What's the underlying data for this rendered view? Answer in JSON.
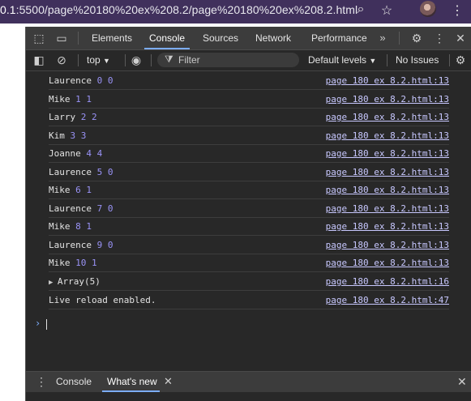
{
  "browser": {
    "url_bold": "0.1",
    "url_rest": ":5500/page%20180%20ex%208.2/page%20180%20ex%208.2.html"
  },
  "devtools": {
    "tabs": [
      "Elements",
      "Console",
      "Sources",
      "Network",
      "Performance"
    ],
    "active_tab": "Console",
    "toolbar": {
      "context": "top",
      "filter_placeholder": "Filter",
      "levels": "Default levels",
      "issues": "No Issues"
    },
    "console_rows": [
      {
        "name": "Laurence",
        "a": "0",
        "b": "0",
        "source": "page 180 ex 8.2.html:13"
      },
      {
        "name": "Mike",
        "a": "1",
        "b": "1",
        "source": "page 180 ex 8.2.html:13"
      },
      {
        "name": "Larry",
        "a": "2",
        "b": "2",
        "source": "page 180 ex 8.2.html:13"
      },
      {
        "name": "Kim",
        "a": "3",
        "b": "3",
        "source": "page 180 ex 8.2.html:13"
      },
      {
        "name": "Joanne",
        "a": "4",
        "b": "4",
        "source": "page 180 ex 8.2.html:13"
      },
      {
        "name": "Laurence",
        "a": "5",
        "b": "0",
        "source": "page 180 ex 8.2.html:13"
      },
      {
        "name": "Mike",
        "a": "6",
        "b": "1",
        "source": "page 180 ex 8.2.html:13"
      },
      {
        "name": "Laurence",
        "a": "7",
        "b": "0",
        "source": "page 180 ex 8.2.html:13"
      },
      {
        "name": "Mike",
        "a": "8",
        "b": "1",
        "source": "page 180 ex 8.2.html:13"
      },
      {
        "name": "Laurence",
        "a": "9",
        "b": "0",
        "source": "page 180 ex 8.2.html:13"
      },
      {
        "name": "Mike",
        "a": "10",
        "b": "1",
        "source": "page 180 ex 8.2.html:13"
      }
    ],
    "array_row": {
      "label": "Array(5)",
      "source": "page 180 ex 8.2.html:16"
    },
    "reload_row": {
      "label": "Live reload enabled.",
      "source": "page 180 ex 8.2.html:47"
    },
    "drawer": {
      "tabs": [
        "Console",
        "What's new"
      ],
      "active_tab": "What's new"
    }
  },
  "colors": {
    "browser_bar": "#40305c",
    "panel_bg": "#282828",
    "tab_bg": "#3c3c3c",
    "accent": "#7cacf8",
    "number": "#9a93f7"
  }
}
